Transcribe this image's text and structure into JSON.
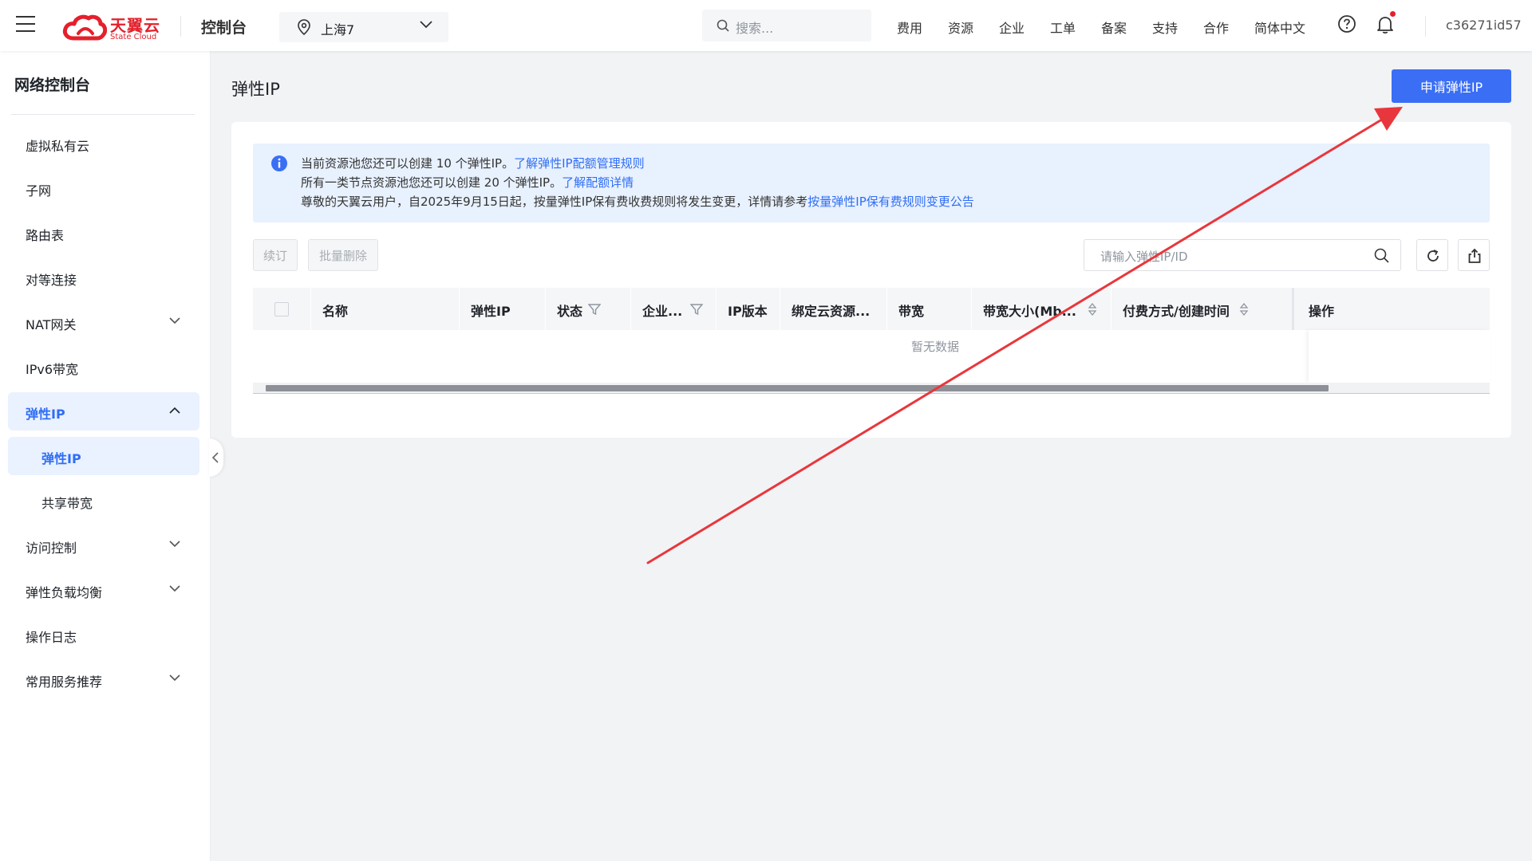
{
  "header": {
    "brand_name": "天翼云",
    "brand_sub": "State Cloud",
    "console_label": "控制台",
    "region": "上海7",
    "search_placeholder": "搜索...",
    "nav": [
      "费用",
      "资源",
      "企业",
      "工单",
      "备案",
      "支持",
      "合作",
      "简体中文"
    ],
    "username": "c36271id57",
    "colors": {
      "brand": "#e4202b",
      "accent": "#3a6ef5"
    }
  },
  "sidebar": {
    "title": "网络控制台",
    "items": [
      {
        "label": "虚拟私有云"
      },
      {
        "label": "子网"
      },
      {
        "label": "路由表"
      },
      {
        "label": "对等连接"
      },
      {
        "label": "NAT网关"
      },
      {
        "label": "IPv6带宽"
      },
      {
        "label": "弹性IP"
      },
      {
        "label": "弹性IP"
      },
      {
        "label": "共享带宽"
      },
      {
        "label": "访问控制"
      },
      {
        "label": "弹性负载均衡"
      },
      {
        "label": "操作日志"
      },
      {
        "label": "常用服务推荐"
      }
    ]
  },
  "main": {
    "page_title": "弹性IP",
    "apply_button": "申请弹性IP",
    "notice": {
      "line1_text": "当前资源池您还可以创建 10 个弹性IP。",
      "line1_link": "了解弹性IP配额管理规则",
      "line2_text": "所有一类节点资源池您还可以创建 20 个弹性IP。",
      "line2_link": "了解配额详情",
      "line3_text": "尊敬的天翼云用户，自2025年9月15日起，按量弹性IP保有费收费规则将发生变更，详情请参考",
      "line3_link": "按量弹性IP保有费规则变更公告"
    },
    "toolbar": {
      "renew_button": "续订",
      "batch_delete_button": "批量删除",
      "search_placeholder": "请输入弹性IP/ID"
    },
    "table": {
      "columns": [
        "名称",
        "弹性IP",
        "状态",
        "企业...",
        "IP版本",
        "绑定云资源...",
        "带宽",
        "带宽大小(Mb...",
        "付费方式/创建时间",
        "操作"
      ],
      "empty_text": "暂无数据"
    }
  }
}
